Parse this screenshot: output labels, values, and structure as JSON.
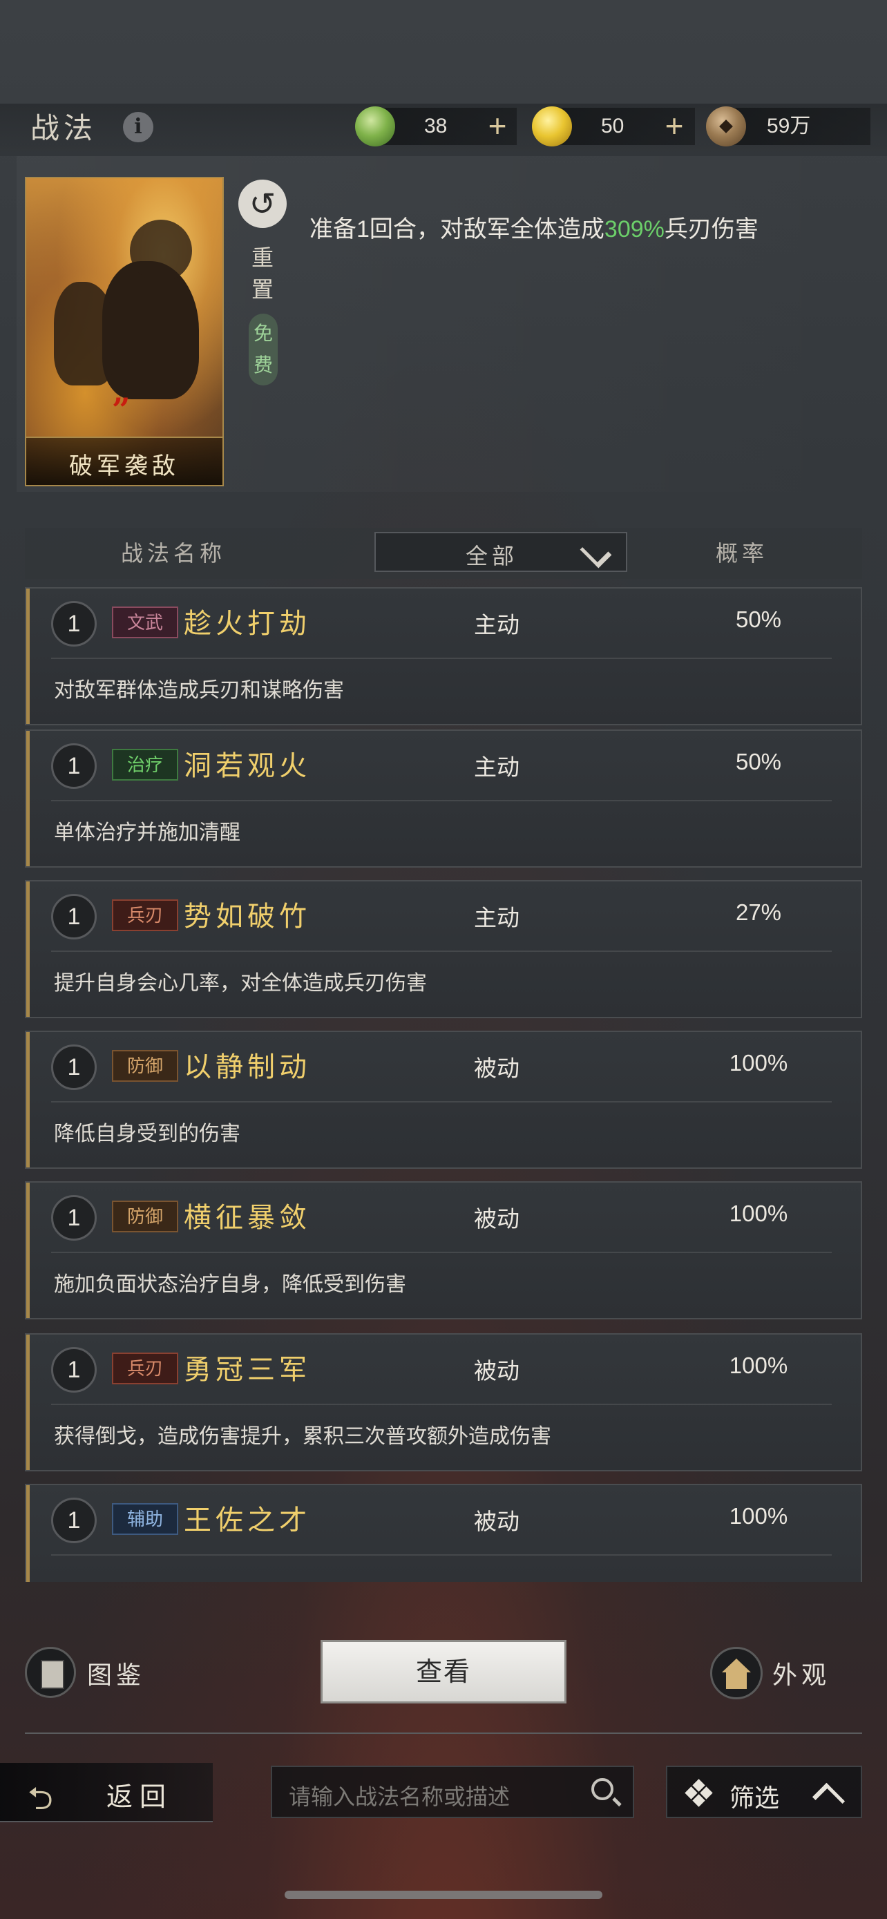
{
  "header": {
    "title": "战法",
    "info_icon": "i",
    "resources": [
      {
        "icon": "jade-coin-icon",
        "value": "38",
        "plus": "+",
        "color": "#7fb24a"
      },
      {
        "icon": "gold-coin-icon",
        "value": "50",
        "plus": "+",
        "color": "#e9c531"
      },
      {
        "icon": "copper-coin-icon",
        "value": "59万",
        "color": "#9a7a52"
      }
    ]
  },
  "preview": {
    "card_name": "破军袭敌",
    "card_mark": "”",
    "reset_icon": "↺",
    "reset_label": "重置",
    "free_label": "免费",
    "desc_before": "准备1回合，对敌军全体造成",
    "desc_highlight": "309%",
    "desc_after": "兵刃伤害"
  },
  "list_header": {
    "name_col": "战法名称",
    "filter_value": "全部",
    "rate_col": "概率"
  },
  "skills": [
    {
      "level": "1",
      "tag": "文武",
      "tag_color": "#c9859a",
      "tag_bg": "#3a1e2a",
      "name": "趁火打劫",
      "type": "主动",
      "rate": "50%",
      "desc": "对敌军群体造成兵刃和谋略伤害"
    },
    {
      "level": "1",
      "tag": "治疗",
      "tag_color": "#6fcf6a",
      "tag_bg": "#1d3522",
      "name": "洞若观火",
      "type": "主动",
      "rate": "50%",
      "desc": "单体治疗并施加清醒"
    },
    {
      "level": "1",
      "tag": "兵刃",
      "tag_color": "#d88a6a",
      "tag_bg": "#3e1c18",
      "name": "势如破竹",
      "type": "主动",
      "rate": "27%",
      "desc": "提升自身会心几率，对全体造成兵刃伤害"
    },
    {
      "level": "1",
      "tag": "防御",
      "tag_color": "#d5a56a",
      "tag_bg": "#3a2818",
      "name": "以静制动",
      "type": "被动",
      "rate": "100%",
      "desc": "降低自身受到的伤害"
    },
    {
      "level": "1",
      "tag": "防御",
      "tag_color": "#d5a56a",
      "tag_bg": "#3a2818",
      "name": "横征暴敛",
      "type": "被动",
      "rate": "100%",
      "desc": "施加负面状态治疗自身，降低受到伤害"
    },
    {
      "level": "1",
      "tag": "兵刃",
      "tag_color": "#d88a6a",
      "tag_bg": "#3e1c18",
      "name": "勇冠三军",
      "type": "被动",
      "rate": "100%",
      "desc": "获得倒戈，造成伤害提升，累积三次普攻额外造成伤害"
    },
    {
      "level": "1",
      "tag": "辅助",
      "tag_color": "#8fb4e0",
      "tag_bg": "#1c2a3e",
      "name": "王佐之才",
      "type": "被动",
      "rate": "100%",
      "desc": ""
    }
  ],
  "bottom": {
    "book_label": "图鉴",
    "view_label": "查看",
    "look_label": "外观",
    "back_label": "返回",
    "search_placeholder": "请输入战法名称或描述",
    "filter_label": "筛选"
  }
}
